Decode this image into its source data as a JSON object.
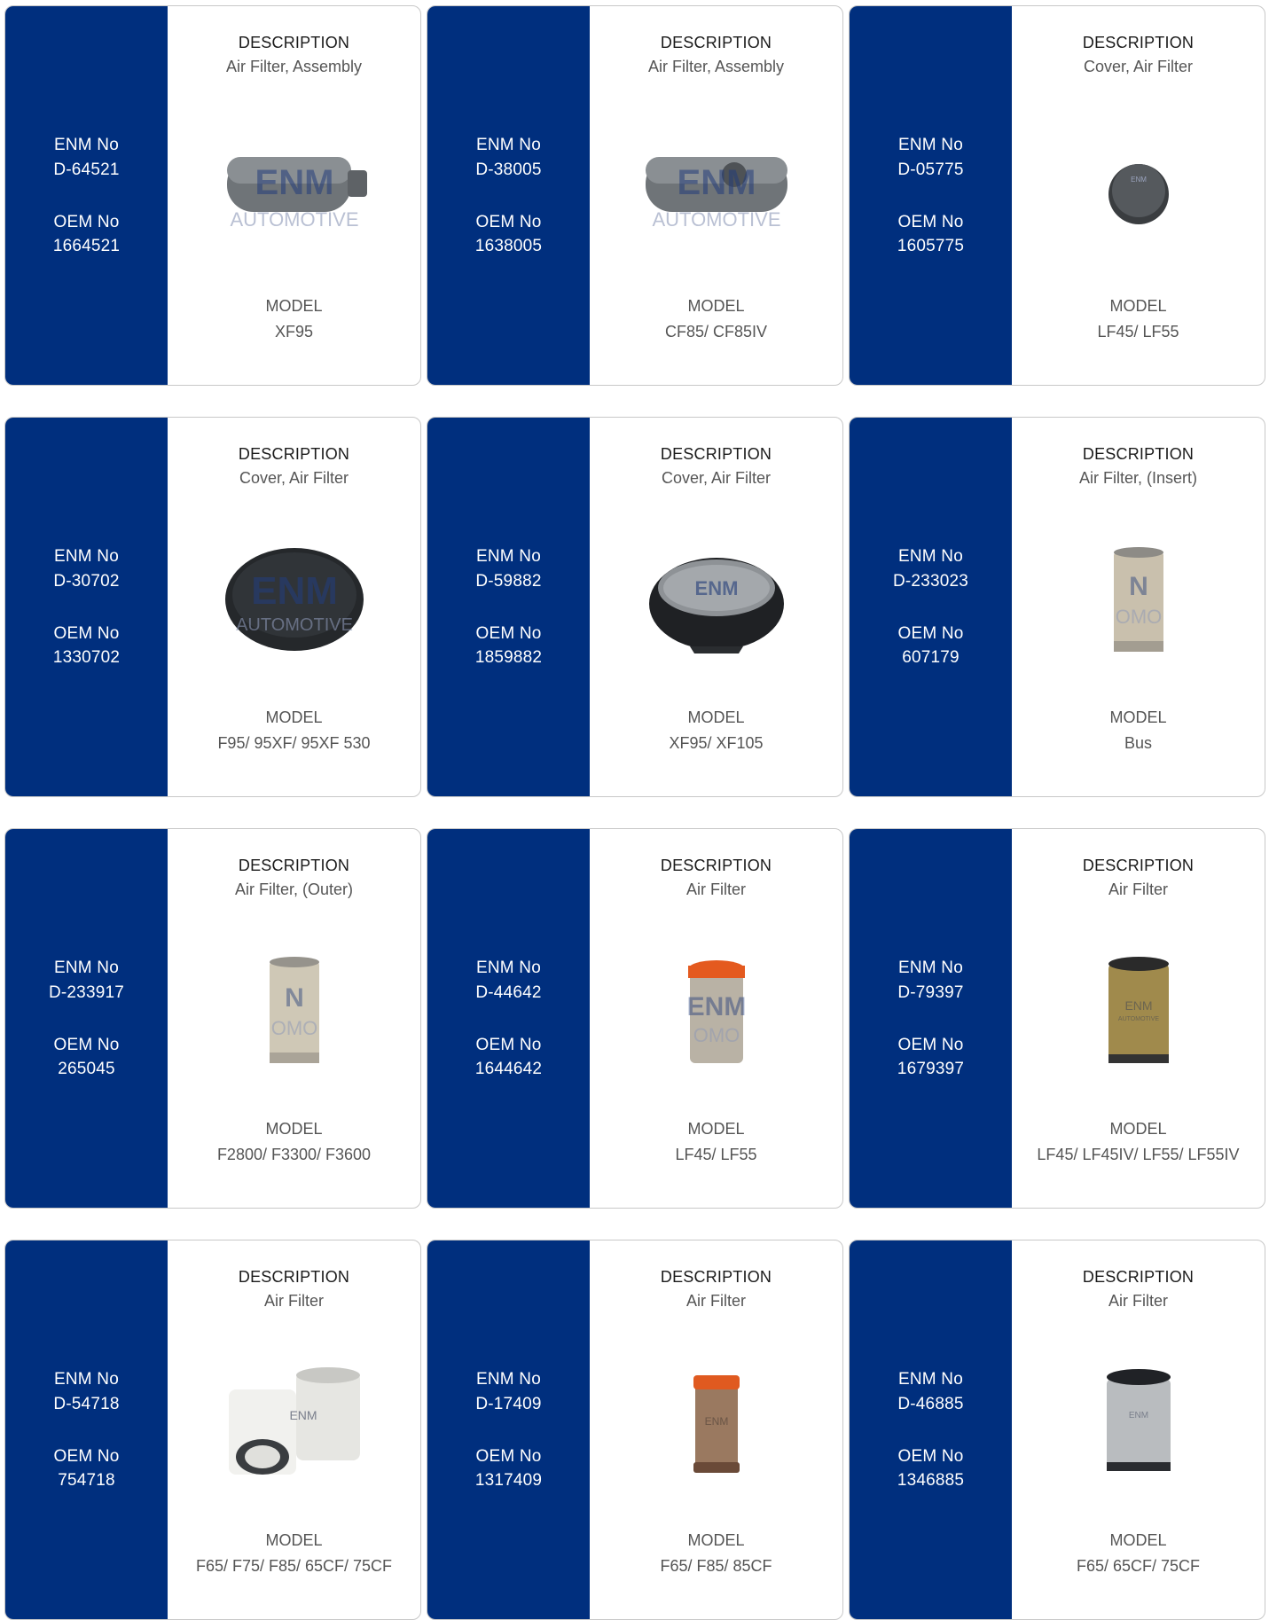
{
  "labels": {
    "enm": "ENM No",
    "oem": "OEM No",
    "description": "DESCRIPTION",
    "model": "MODEL"
  },
  "colors": {
    "sidebar": "#002f7e",
    "watermark": "ENM AUTOMOTIVE"
  },
  "products": [
    {
      "enm": "D-64521",
      "oem": "1664521",
      "description": "Air Filter, Assembly",
      "model": "XF95",
      "image_icon": "air-filter-assembly-icon"
    },
    {
      "enm": "D-38005",
      "oem": "1638005",
      "description": "Air Filter, Assembly",
      "model": "CF85/ CF85IV",
      "image_icon": "air-filter-assembly-icon"
    },
    {
      "enm": "D-05775",
      "oem": "1605775",
      "description": "Cover, Air Filter",
      "model": "LF45/ LF55",
      "image_icon": "round-cap-icon"
    },
    {
      "enm": "D-30702",
      "oem": "1330702",
      "description": "Cover, Air Filter",
      "model": "F95/ 95XF/ 95XF 530",
      "image_icon": "oval-cover-icon"
    },
    {
      "enm": "D-59882",
      "oem": "1859882",
      "description": "Cover, Air Filter",
      "model": "XF95/ XF105",
      "image_icon": "dome-cover-icon"
    },
    {
      "enm": "D-233023",
      "oem": "607179",
      "description": "Air Filter, (Insert)",
      "model": "Bus",
      "image_icon": "cylinder-filter-icon"
    },
    {
      "enm": "D-233917",
      "oem": "265045",
      "description": "Air Filter, (Outer)",
      "model": "F2800/ F3300/ F3600",
      "image_icon": "cylinder-filter-icon"
    },
    {
      "enm": "D-44642",
      "oem": "1644642",
      "description": "Air Filter",
      "model": "LF45/ LF55",
      "image_icon": "orange-cap-filter-icon"
    },
    {
      "enm": "D-79397",
      "oem": "1679397",
      "description": "Air Filter",
      "model": "LF45/ LF45IV/ LF55/ LF55IV",
      "image_icon": "mesh-filter-icon"
    },
    {
      "enm": "D-54718",
      "oem": "754718",
      "description": "Air Filter",
      "model": "F65/ F75/ F85/ 65CF/ 75CF",
      "image_icon": "filter-pair-icon"
    },
    {
      "enm": "D-17409",
      "oem": "1317409",
      "description": "Air Filter",
      "model": "F65/ F85/ 85CF",
      "image_icon": "orange-cap-filter-icon"
    },
    {
      "enm": "D-46885",
      "oem": "1346885",
      "description": "Air Filter",
      "model": "F65/ 65CF/ 75CF",
      "image_icon": "metal-filter-icon"
    }
  ]
}
